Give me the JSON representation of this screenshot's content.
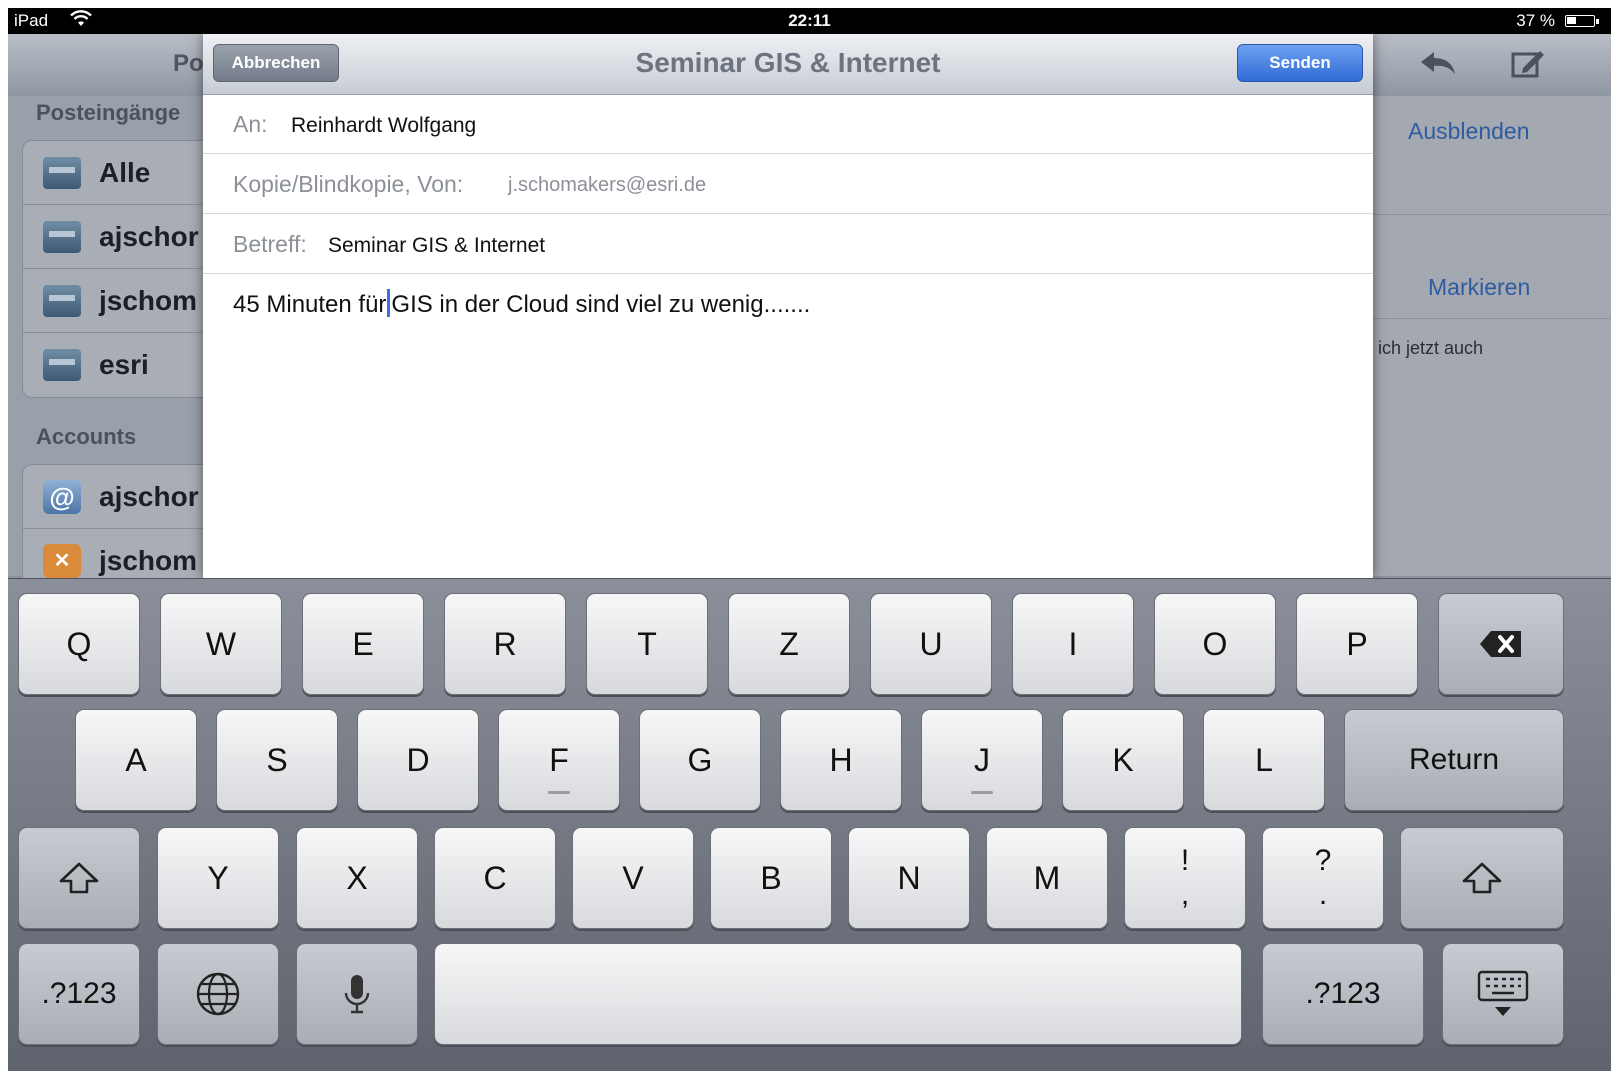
{
  "status": {
    "carrier": "iPad",
    "time": "22:11",
    "battery": "37 %",
    "battery_level": 0.37
  },
  "background": {
    "title_fragment": "Po",
    "section_inboxes": "Posteingänge",
    "mailboxes": [
      "Alle",
      "ajschor",
      "jschom",
      "esri"
    ],
    "section_accounts": "Accounts",
    "accounts": [
      "ajschor",
      "jschom"
    ],
    "hide_link": "Ausblenden",
    "mark_link": "Markieren",
    "snippet": "ich jetzt auch"
  },
  "compose": {
    "cancel": "Abbrechen",
    "title": "Seminar GIS & Internet",
    "send": "Senden",
    "to_label": "An:",
    "to_value": "Reinhardt Wolfgang",
    "cc_label": "Kopie/Blindkopie, Von:",
    "cc_value": "j.schomakers@esri.de",
    "subject_label": "Betreff:",
    "subject_value": "Seminar GIS & Internet",
    "body_before_caret": "45 Minuten für",
    "body_after_caret": "GIS in der Cloud sind viel zu wenig......."
  },
  "keyboard": {
    "row1": [
      "Q",
      "W",
      "E",
      "R",
      "T",
      "Z",
      "U",
      "I",
      "O",
      "P"
    ],
    "row2": [
      "A",
      "S",
      "D",
      "F",
      "G",
      "H",
      "J",
      "K",
      "L"
    ],
    "row3": [
      "Y",
      "X",
      "C",
      "V",
      "B",
      "N",
      "M"
    ],
    "return": "Return",
    "excl_top": "!",
    "excl_bottom": ",",
    "quest_top": "?",
    "quest_bottom": ".",
    "numbers": ".?123"
  }
}
